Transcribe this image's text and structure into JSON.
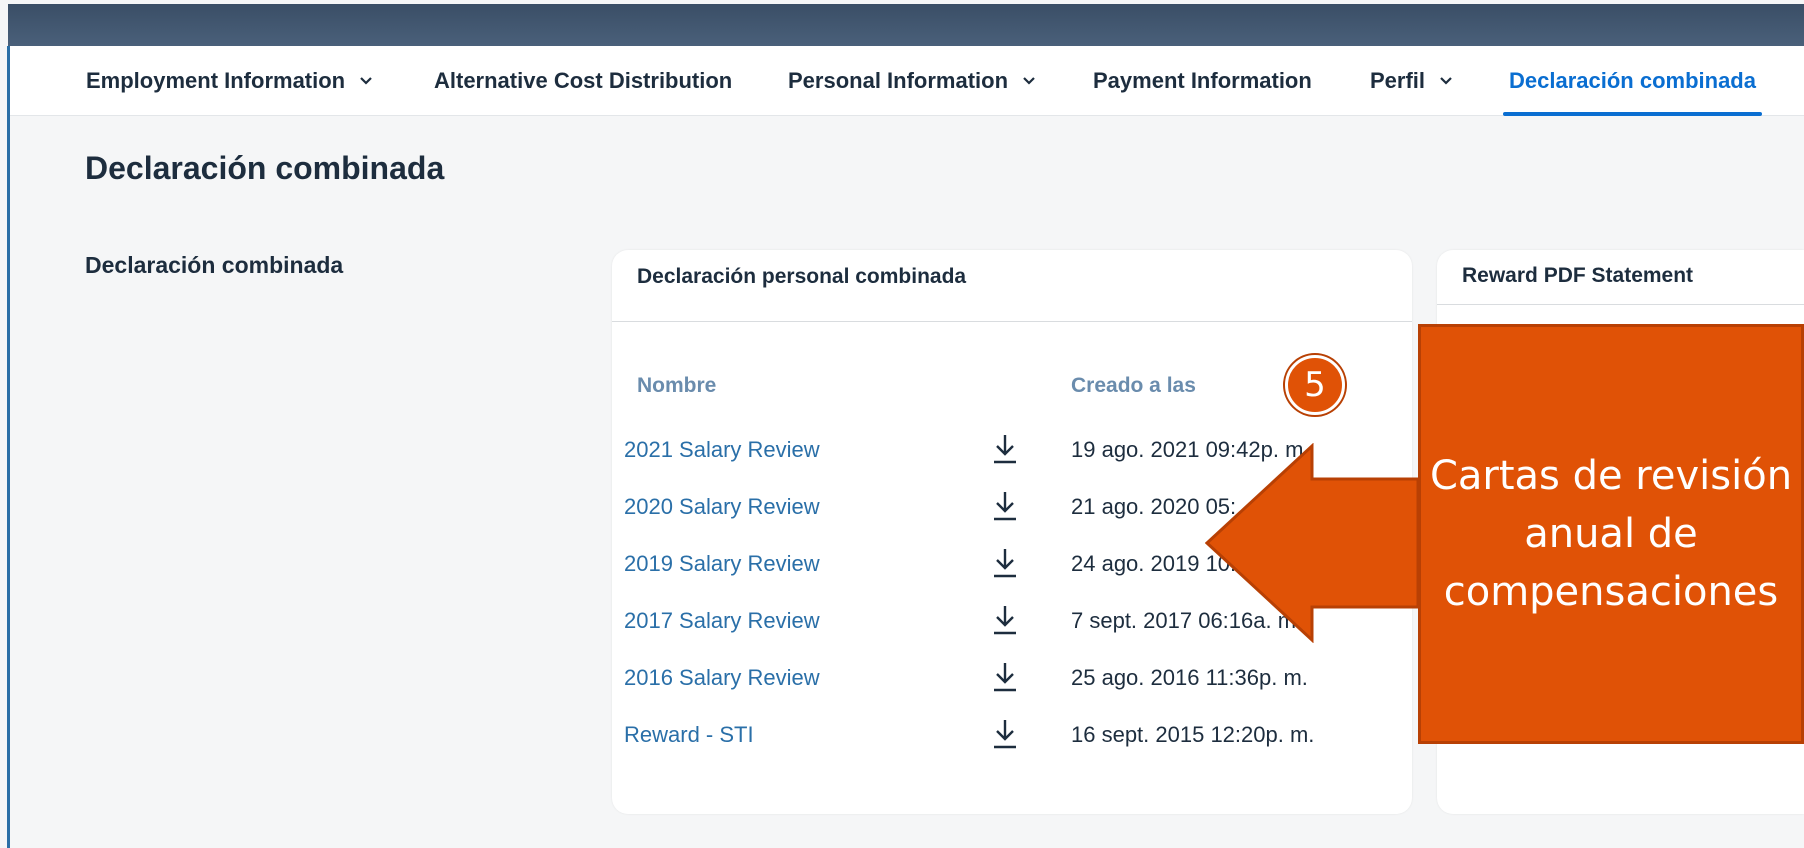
{
  "nav": {
    "items": [
      {
        "label": "Employment Information",
        "has_dropdown": true,
        "active": false
      },
      {
        "label": "Alternative Cost Distribution",
        "has_dropdown": false,
        "active": false
      },
      {
        "label": "Personal Information",
        "has_dropdown": true,
        "active": false
      },
      {
        "label": "Payment Information",
        "has_dropdown": false,
        "active": false
      },
      {
        "label": "Perfil",
        "has_dropdown": true,
        "active": false
      },
      {
        "label": "Declaración combinada",
        "has_dropdown": false,
        "active": true
      }
    ]
  },
  "page": {
    "title": "Declaración combinada",
    "section_label": "Declaración combinada"
  },
  "combined_card": {
    "title": "Declaración personal combinada",
    "columns": {
      "name": "Nombre",
      "created": "Creado a las"
    },
    "rows": [
      {
        "name": "2021 Salary Review",
        "created": "19 ago. 2021 09:42p. m."
      },
      {
        "name": "2020 Salary Review",
        "created": "21 ago. 2020 05:"
      },
      {
        "name": "2019 Salary Review",
        "created": "24 ago. 2019 10:02"
      },
      {
        "name": "2017 Salary Review",
        "created": "7 sept. 2017 06:16a. m."
      },
      {
        "name": "2016 Salary Review",
        "created": "25 ago. 2016 11:36p. m."
      },
      {
        "name": "Reward - STI",
        "created": "16 sept. 2015 12:20p. m."
      }
    ]
  },
  "reward_card": {
    "title": "Reward PDF Statement"
  },
  "annotation": {
    "step_number": "5",
    "text": "Cartas de revisión\nanual de\ncompensaciones",
    "color": "#e05206"
  },
  "icons": {
    "download": "download-icon",
    "dropdown": "chevron-down-icon"
  }
}
